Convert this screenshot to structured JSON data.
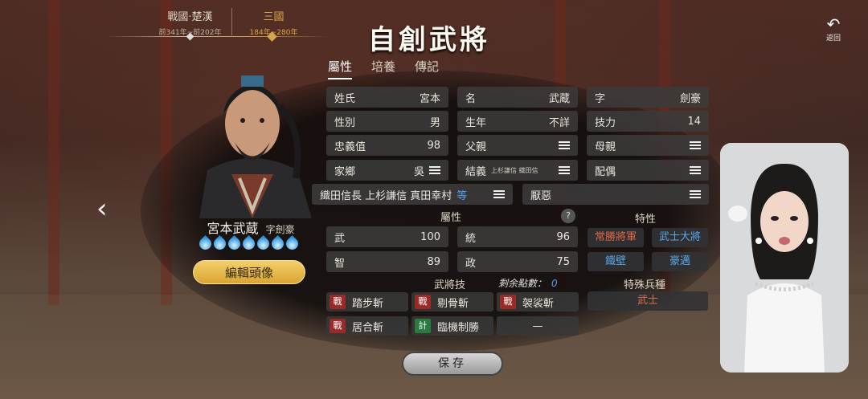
{
  "eras": [
    {
      "title": "戰國·楚漢",
      "range": "前341年~前202年"
    },
    {
      "title": "三國",
      "range": "184年~280年"
    }
  ],
  "page_title": "自創武將",
  "back_label": "返回",
  "tabs": [
    "屬性",
    "培養",
    "傳記"
  ],
  "portrait": {
    "name": "宮本武蔵",
    "zi": "字劍豪",
    "star_count": 7,
    "edit_label": "編輯頭像"
  },
  "info": {
    "surname": {
      "label": "姓氏",
      "value": "宮本"
    },
    "given": {
      "label": "名",
      "value": "武蔵"
    },
    "style": {
      "label": "字",
      "value": "劍豪"
    },
    "gender": {
      "label": "性別",
      "value": "男"
    },
    "birth": {
      "label": "生年",
      "value": "不詳"
    },
    "skill_power": {
      "label": "技力",
      "value": "14"
    },
    "loyalty": {
      "label": "忠義值",
      "value": "98"
    },
    "father": {
      "label": "父親"
    },
    "mother": {
      "label": "母親"
    },
    "hometown": {
      "label": "家鄉",
      "value": "吳"
    },
    "sworn": {
      "label": "結義",
      "value": "上杉謙信 織田信"
    },
    "spouse": {
      "label": "配偶"
    },
    "friends": {
      "value": "織田信長 上杉謙信 真田幸村",
      "suffix": "等"
    },
    "dislike": {
      "label": "厭惡"
    }
  },
  "attributes": {
    "title": "屬性",
    "help": "?",
    "items": [
      {
        "label": "武",
        "value": "100"
      },
      {
        "label": "統",
        "value": "96"
      },
      {
        "label": "智",
        "value": "89"
      },
      {
        "label": "政",
        "value": "75"
      }
    ]
  },
  "traits": {
    "title": "特性",
    "items": [
      {
        "label": "常勝將軍",
        "color": "#e06a4a"
      },
      {
        "label": "武士大將",
        "color": "#5aa7e8"
      },
      {
        "label": "鐵壁",
        "color": "#5aa7e8"
      },
      {
        "label": "豪邁",
        "color": "#5aa7e8"
      }
    ]
  },
  "skills": {
    "title": "武將技",
    "remaining_label": "剩余點數：",
    "remaining": "0",
    "items": [
      {
        "tag": "戰",
        "label": "踏步斬"
      },
      {
        "tag": "戰",
        "label": "剔骨斬"
      },
      {
        "tag": "戰",
        "label": "袈裟斬"
      },
      {
        "tag": "戰",
        "label": "居合斬"
      },
      {
        "tag": "計",
        "label": "臨機制勝"
      },
      {
        "tag": "",
        "label": "—"
      }
    ]
  },
  "special_troop": {
    "title": "特殊兵種",
    "value": "武士"
  },
  "save_label": "保存",
  "colors": {
    "accent_gold": "#d7a54a",
    "edit_button": "#e7bb4a",
    "blue_value": "#4f9ef0",
    "trait_red": "#e06a4a"
  }
}
